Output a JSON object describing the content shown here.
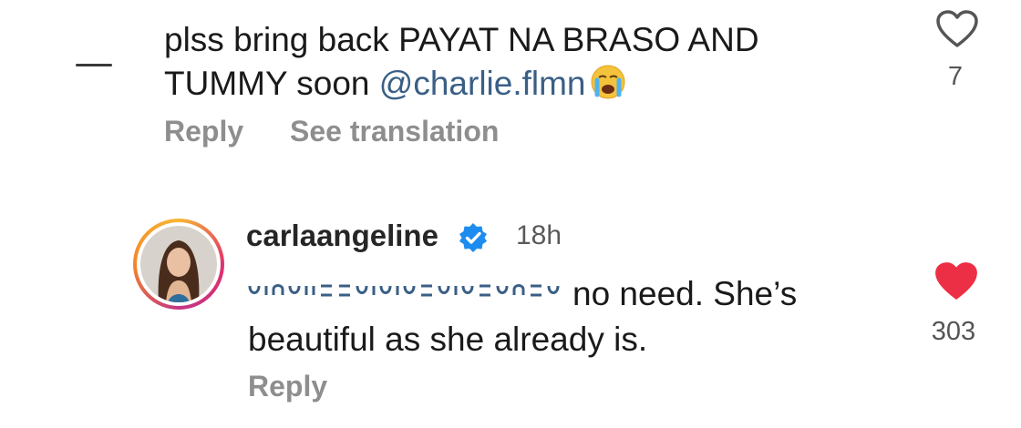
{
  "comment1": {
    "text": "plss bring back PAYAT NA BRASO AND TUMMY soon ",
    "mention": "@charlie.flmn",
    "emoji": "loudly-crying-face-emoji",
    "likes": "7",
    "reply_label": "Reply",
    "translation_label": "See translation",
    "liked": false
  },
  "comment2": {
    "username": "carlaangeline",
    "verified": true,
    "time": "18h",
    "text": "no need. She’s beautiful as she already is.",
    "likes": "303",
    "reply_label": "Reply",
    "liked": true
  },
  "colors": {
    "mention": "#3a5f86",
    "liked_heart": "#ed2f45",
    "verified_badge": "#1d8cf0",
    "meta_gray": "#8e8e8e"
  }
}
